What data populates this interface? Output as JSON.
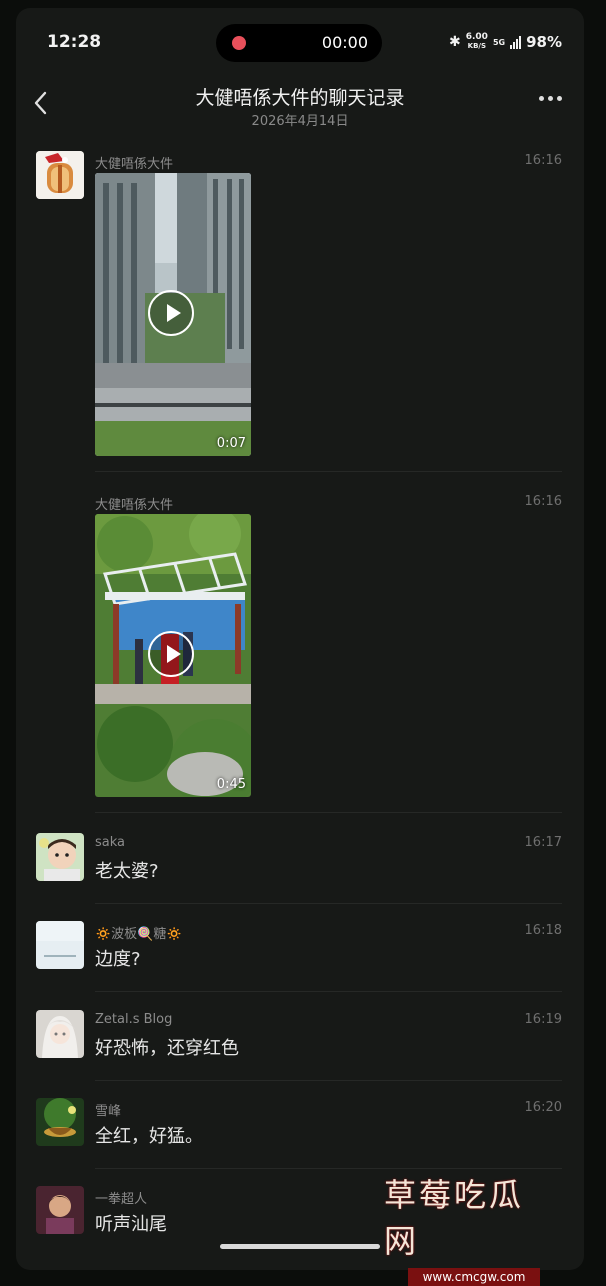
{
  "status": {
    "time": "12:28",
    "recording_time": "00:00",
    "net_speed": "6.00",
    "net_unit": "KB/S",
    "signal": "5G",
    "battery": "98%"
  },
  "header": {
    "title": "大健唔係大件的聊天记录",
    "date": "2026年4月14日"
  },
  "messages": [
    {
      "nick": "大健唔係大件",
      "time": "16:16",
      "type": "video",
      "duration": "0:07"
    },
    {
      "nick": "大健唔係大件",
      "time": "16:16",
      "type": "video",
      "duration": "0:45"
    },
    {
      "nick": "saka",
      "time": "16:17",
      "type": "text",
      "text": "老太婆?"
    },
    {
      "nick": "🔅波板🍭糖🔅",
      "time": "16:18",
      "type": "text",
      "text": "边度?"
    },
    {
      "nick": "Zetal.s Blog",
      "time": "16:19",
      "type": "text",
      "text": "好恐怖，还穿红色"
    },
    {
      "nick": "雪峰",
      "time": "16:20",
      "type": "text",
      "text": "全红，好猛。"
    },
    {
      "nick": "一拳超人",
      "time": "",
      "type": "text",
      "text": "听声汕尾"
    }
  ],
  "watermark": {
    "text": "草莓吃瓜网",
    "url": "www.cmcgw.com"
  },
  "colors": {
    "background": "#171917",
    "text": "#e6e6e6",
    "muted": "#8c8c8c",
    "record_dot": "#e8505b"
  }
}
